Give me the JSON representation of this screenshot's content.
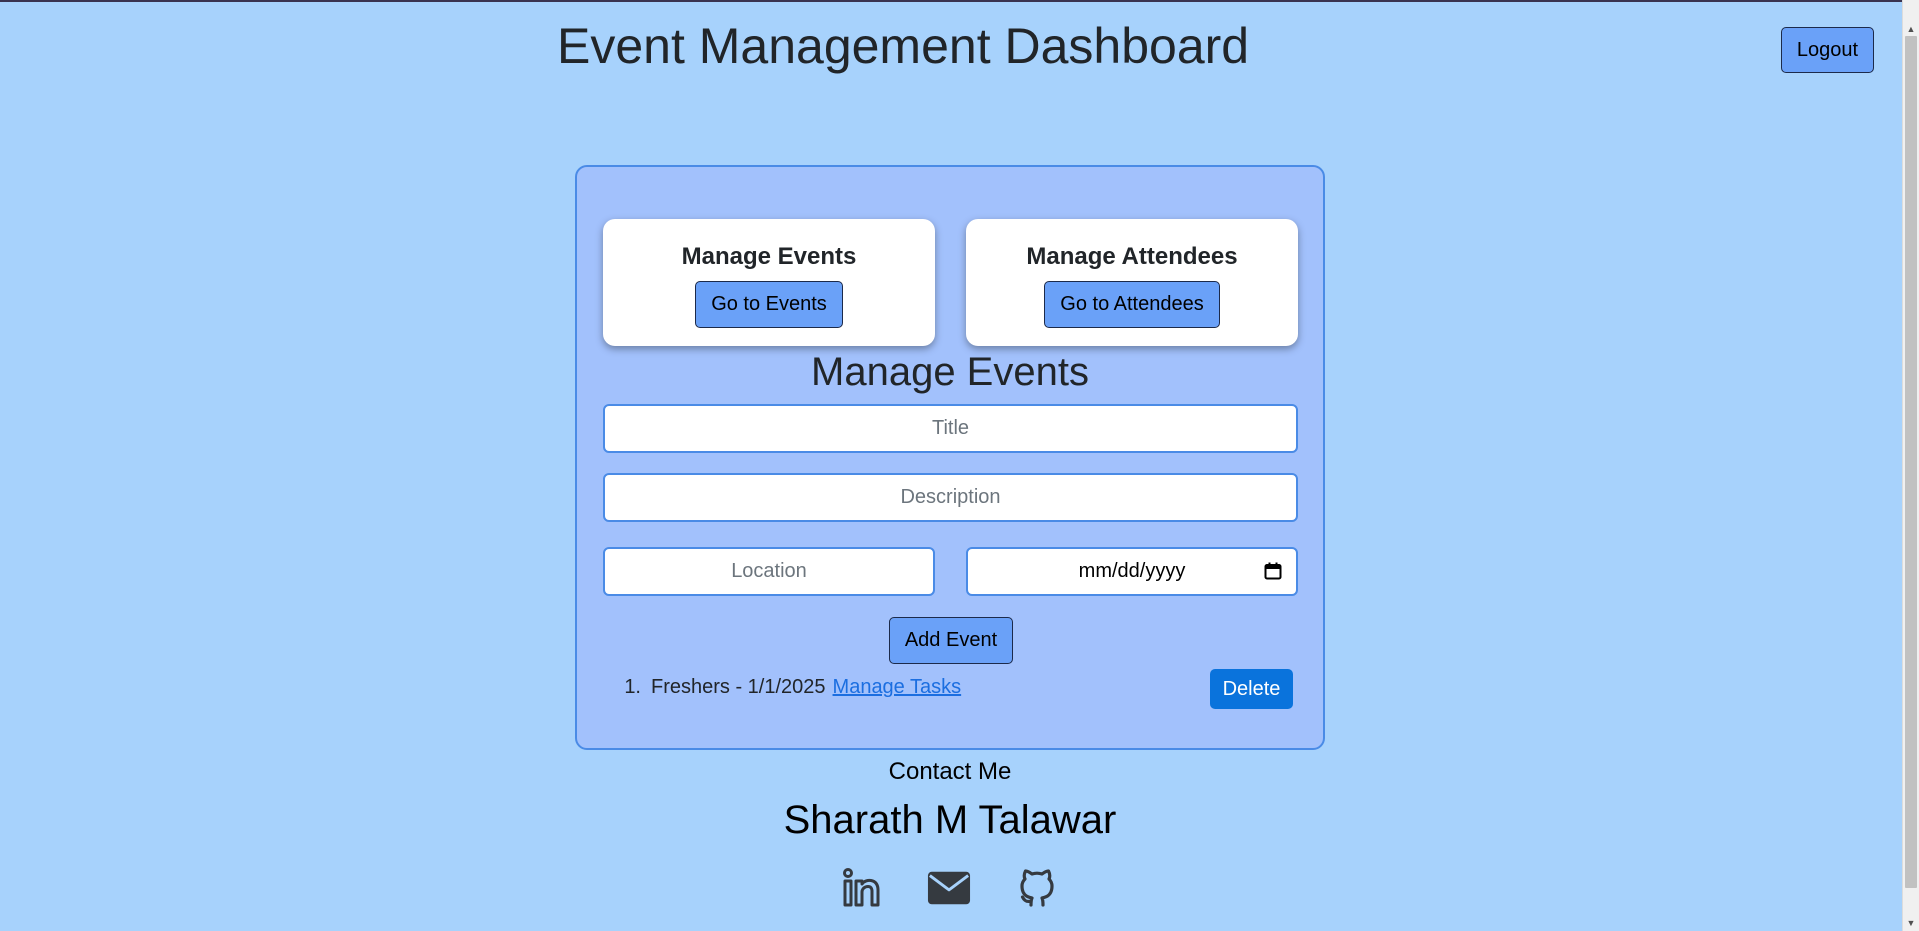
{
  "header": {
    "title": "Event Management Dashboard",
    "logout_label": "Logout"
  },
  "cards": [
    {
      "title": "Manage Events",
      "button_label": "Go to Events"
    },
    {
      "title": "Manage Attendees",
      "button_label": "Go to Attendees"
    }
  ],
  "form": {
    "section_title": "Manage Events",
    "title_placeholder": "Title",
    "description_placeholder": "Description",
    "location_placeholder": "Location",
    "date_placeholder": "mm/dd/yyyy",
    "add_button_label": "Add Event"
  },
  "events": [
    {
      "number": "1.",
      "text": "Freshers - 1/1/2025",
      "link_label": "Manage Tasks",
      "delete_label": "Delete"
    }
  ],
  "footer": {
    "contact_heading": "Contact Me",
    "name": "Sharath M Talawar",
    "social_icons": [
      "linkedin-icon",
      "mail-icon",
      "github-icon"
    ]
  },
  "colors": {
    "background": "#a7d2fc",
    "panel": "#a2c1fc",
    "button": "#6aa1f8",
    "delete_button": "#0a73dc",
    "link": "#1b6ee0"
  }
}
